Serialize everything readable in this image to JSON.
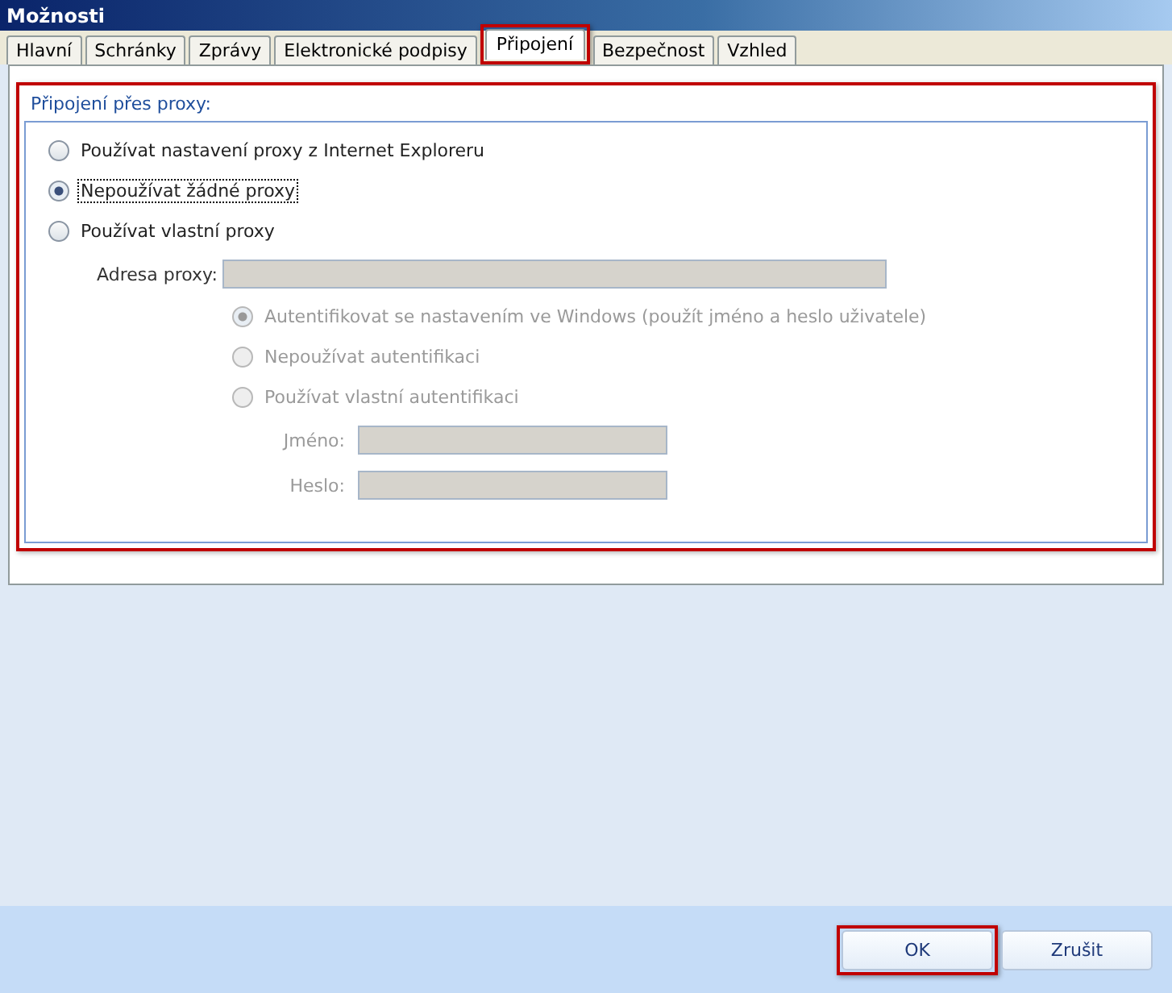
{
  "window": {
    "title": "Možnosti"
  },
  "tabs": [
    {
      "label": "Hlavní",
      "selected": false,
      "highlighted": false
    },
    {
      "label": "Schránky",
      "selected": false,
      "highlighted": false
    },
    {
      "label": "Zprávy",
      "selected": false,
      "highlighted": false
    },
    {
      "label": "Elektronické podpisy",
      "selected": false,
      "highlighted": false
    },
    {
      "label": "Připojení",
      "selected": true,
      "highlighted": true
    },
    {
      "label": "Bezpečnost",
      "selected": false,
      "highlighted": false
    },
    {
      "label": "Vzhled",
      "selected": false,
      "highlighted": false
    }
  ],
  "group": {
    "title": "Připojení přes proxy:",
    "highlighted": true,
    "proxy_options": [
      {
        "label": "Používat nastavení proxy z Internet Exploreru",
        "selected": false,
        "focused": false
      },
      {
        "label": "Nepoužívat žádné proxy",
        "selected": true,
        "focused": true
      },
      {
        "label": "Používat vlastní proxy",
        "selected": false,
        "focused": false
      }
    ],
    "proxy_address": {
      "label": "Adresa proxy:",
      "disabled": true
    },
    "auth_options": [
      {
        "label": "Autentifikovat se nastavením ve Windows (použít jméno a heslo uživatele)",
        "selected": true,
        "disabled": true
      },
      {
        "label": "Nepoužívat autentifikaci",
        "selected": false,
        "disabled": true
      },
      {
        "label": "Používat vlastní autentifikaci",
        "selected": false,
        "disabled": true
      }
    ],
    "credentials": [
      {
        "label": "Jméno:",
        "disabled": true
      },
      {
        "label": "Heslo:",
        "disabled": true
      }
    ]
  },
  "buttons": [
    {
      "label": "OK",
      "highlighted": true
    },
    {
      "label": "Zrušit",
      "highlighted": false
    }
  ]
}
